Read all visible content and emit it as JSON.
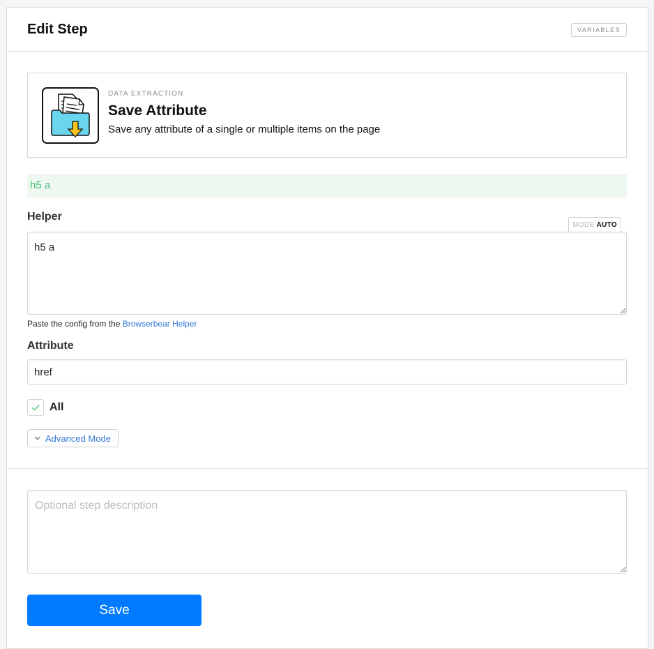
{
  "header": {
    "title": "Edit Step",
    "variables_label": "VARIABLES"
  },
  "step": {
    "category": "DATA EXTRACTION",
    "name": "Save Attribute",
    "description": "Save any attribute of a single or multiple items on the page",
    "icon": "folder-download-icon"
  },
  "selector_preview": "h5 a",
  "helper": {
    "label": "Helper",
    "mode_prefix": "MODE",
    "mode_value": "AUTO",
    "value": "h5 a",
    "hint_text": "Paste the config from the ",
    "hint_link": "Browserbear Helper"
  },
  "attribute": {
    "label": "Attribute",
    "value": "href"
  },
  "all_checkbox": {
    "label": "All",
    "checked": true
  },
  "advanced_mode_label": "Advanced Mode",
  "description_field": {
    "placeholder": "Optional step description",
    "value": ""
  },
  "save_label": "Save",
  "colors": {
    "primary": "#007bff",
    "success_text": "#4cbf7a",
    "success_bg": "#eef8f1",
    "link": "#3578d6"
  }
}
